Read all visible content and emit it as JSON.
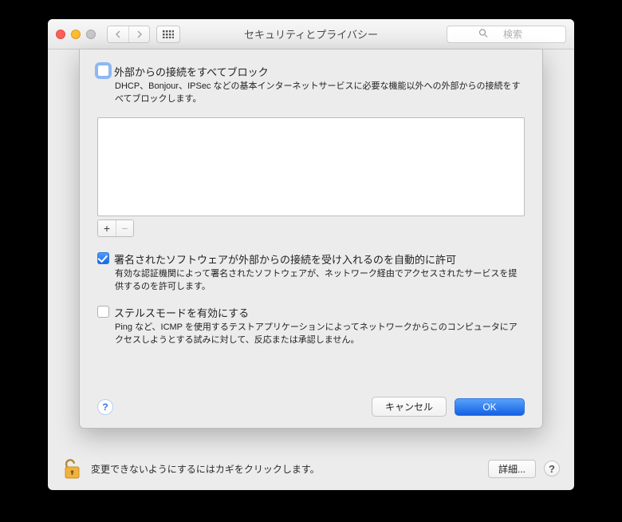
{
  "window": {
    "title": "セキュリティとプライバシー"
  },
  "toolbar": {
    "search_placeholder": "検索"
  },
  "sheet": {
    "block_all": {
      "label": "外部からの接続をすべてブロック",
      "desc": "DHCP、Bonjour、IPSec などの基本インターネットサービスに必要な機能以外への外部からの接続をすべてブロックします。",
      "checked": false
    },
    "auto_allow_signed": {
      "label": "署名されたソフトウェアが外部からの接続を受け入れるのを自動的に許可",
      "desc": "有効な認証機関によって署名されたソフトウェアが、ネットワーク経由でアクセスされたサービスを提供するのを許可します。",
      "checked": true
    },
    "stealth": {
      "label": "ステルスモードを有効にする",
      "desc": "Ping など、ICMP を使用するテストアプリケーションによってネットワークからこのコンピュータにアクセスしようとする試みに対して、反応または承認しません。",
      "checked": false
    },
    "buttons": {
      "cancel": "キャンセル",
      "ok": "OK"
    },
    "add_label": "+",
    "remove_label": "−"
  },
  "bottom": {
    "lock_text": "変更できないようにするにはカギをクリックします。",
    "details": "詳細..."
  }
}
